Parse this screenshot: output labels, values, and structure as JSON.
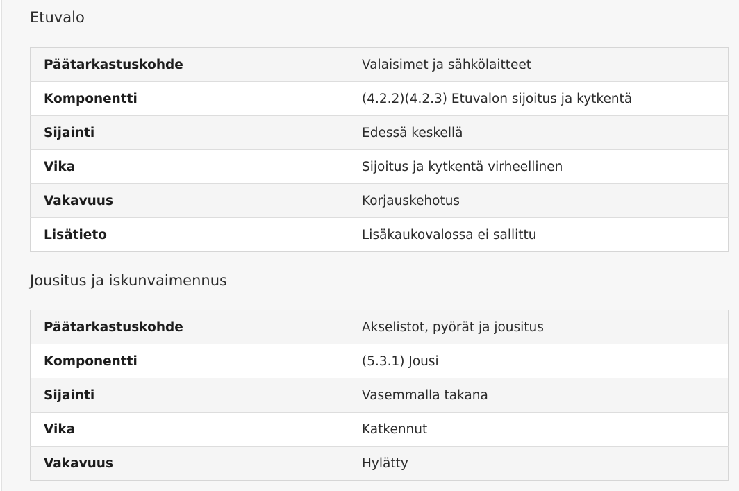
{
  "sections": [
    {
      "title": "Etuvalo",
      "rows": [
        {
          "label": "Päätarkastuskohde",
          "value": "Valaisimet ja sähkölaitteet"
        },
        {
          "label": "Komponentti",
          "value": "(4.2.2)(4.2.3) Etuvalon sijoitus ja kytkentä"
        },
        {
          "label": "Sijainti",
          "value": "Edessä keskellä"
        },
        {
          "label": "Vika",
          "value": "Sijoitus ja kytkentä virheellinen"
        },
        {
          "label": "Vakavuus",
          "value": "Korjauskehotus"
        },
        {
          "label": "Lisätieto",
          "value": "Lisäkaukovalossa ei sallittu"
        }
      ]
    },
    {
      "title": "Jousitus ja iskunvaimennus",
      "rows": [
        {
          "label": "Päätarkastuskohde",
          "value": "Akselistot, pyörät ja jousitus"
        },
        {
          "label": "Komponentti",
          "value": "(5.3.1) Jousi"
        },
        {
          "label": "Sijainti",
          "value": "Vasemmalla takana"
        },
        {
          "label": "Vika",
          "value": "Katkennut"
        },
        {
          "label": "Vakavuus",
          "value": "Hylätty"
        }
      ]
    }
  ]
}
